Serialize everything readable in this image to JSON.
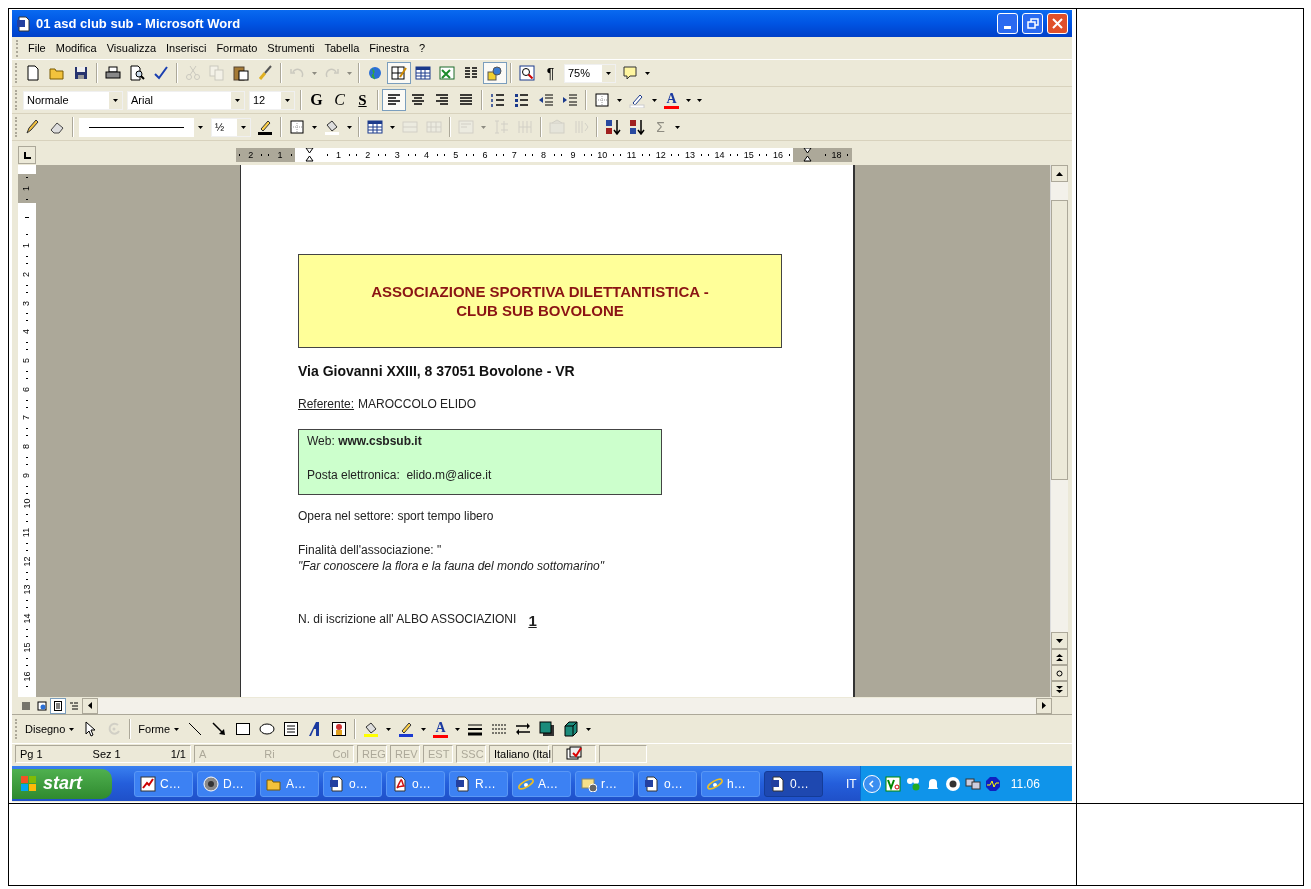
{
  "window": {
    "title": "01 asd club sub - Microsoft Word"
  },
  "menu": [
    {
      "label": "File"
    },
    {
      "label": "Modifica"
    },
    {
      "label": "Visualizza"
    },
    {
      "label": "Inserisci"
    },
    {
      "label": "Formato"
    },
    {
      "label": "Strumenti"
    },
    {
      "label": "Tabella"
    },
    {
      "label": "Finestra"
    },
    {
      "label": "?"
    }
  ],
  "toolbars": [
    {
      "items": [
        {
          "kind": "icon",
          "disabled": false,
          "pressed": false
        },
        {
          "kind": "icon",
          "disabled": false,
          "pressed": false
        },
        {
          "kind": "icon",
          "disabled": false,
          "pressed": false
        },
        {
          "kind": "sep"
        },
        {
          "kind": "icon",
          "disabled": false,
          "pressed": false
        },
        {
          "kind": "icon",
          "disabled": false,
          "pressed": false
        },
        {
          "kind": "icon",
          "disabled": false,
          "pressed": false
        },
        {
          "kind": "sep"
        },
        {
          "kind": "icon",
          "disabled": true,
          "pressed": false
        },
        {
          "kind": "icon",
          "disabled": true,
          "pressed": false
        },
        {
          "kind": "icon",
          "disabled": false,
          "pressed": false
        },
        {
          "kind": "icon",
          "disabled": false,
          "pressed": false
        },
        {
          "kind": "sep"
        },
        {
          "kind": "icon",
          "disabled": true,
          "pressed": false
        },
        {
          "kind": "caret",
          "disabled": true
        },
        {
          "kind": "icon",
          "disabled": true,
          "pressed": false
        },
        {
          "kind": "caret",
          "disabled": true
        },
        {
          "kind": "sep"
        },
        {
          "kind": "icon",
          "disabled": false,
          "pressed": false
        },
        {
          "kind": "icon",
          "disabled": false,
          "pressed": true
        },
        {
          "kind": "icon",
          "disabled": false,
          "pressed": false
        },
        {
          "kind": "icon",
          "disabled": false,
          "pressed": false
        },
        {
          "kind": "icon",
          "disabled": false,
          "pressed": false
        },
        {
          "kind": "icon",
          "disabled": false,
          "pressed": true
        },
        {
          "kind": "sep"
        },
        {
          "kind": "icon",
          "disabled": false,
          "pressed": false
        },
        {
          "kind": "text",
          "label": "¶",
          "disabled": false,
          "pressed": false
        },
        {
          "kind": "combo",
          "value": "75%"
        },
        {
          "kind": "icon",
          "disabled": false,
          "pressed": false
        },
        {
          "kind": "caret",
          "disabled": false
        }
      ]
    },
    {
      "items": [
        {
          "kind": "combo",
          "value": "Normale"
        },
        {
          "kind": "combo",
          "value": "Arial"
        },
        {
          "kind": "combo",
          "value": "12"
        },
        {
          "kind": "sep"
        },
        {
          "kind": "bold",
          "label": "G",
          "disabled": false,
          "pressed": false
        },
        {
          "kind": "italic",
          "label": "C",
          "disabled": false,
          "pressed": false
        },
        {
          "kind": "underline",
          "label": "S",
          "disabled": false,
          "pressed": false
        },
        {
          "kind": "sep"
        },
        {
          "kind": "icon",
          "disabled": false,
          "pressed": true
        },
        {
          "kind": "icon",
          "disabled": false,
          "pressed": false
        },
        {
          "kind": "icon",
          "disabled": false,
          "pressed": false
        },
        {
          "kind": "icon",
          "disabled": false,
          "pressed": false
        },
        {
          "kind": "sep"
        },
        {
          "kind": "icon",
          "disabled": false,
          "pressed": false
        },
        {
          "kind": "icon",
          "disabled": false,
          "pressed": false
        },
        {
          "kind": "icon",
          "disabled": false,
          "pressed": false
        },
        {
          "kind": "icon",
          "disabled": false,
          "pressed": false
        },
        {
          "kind": "sep"
        },
        {
          "kind": "icon",
          "disabled": false,
          "pressed": false
        },
        {
          "kind": "caret",
          "disabled": false
        },
        {
          "kind": "icon",
          "disabled": false,
          "pressed": false
        },
        {
          "kind": "caret",
          "disabled": false
        },
        {
          "kind": "color_text",
          "label": "A",
          "color": "#ff0000",
          "disabled": false,
          "pressed": false
        },
        {
          "kind": "caret",
          "disabled": false
        },
        {
          "kind": "caret",
          "disabled": false
        }
      ]
    },
    {
      "items": [
        {
          "kind": "icon",
          "disabled": false,
          "pressed": false
        },
        {
          "kind": "icon",
          "disabled": false,
          "pressed": false
        },
        {
          "kind": "sep"
        },
        {
          "kind": "line_combo"
        },
        {
          "kind": "combo",
          "value": "½"
        },
        {
          "kind": "icon",
          "disabled": false,
          "pressed": false
        },
        {
          "kind": "sep"
        },
        {
          "kind": "icon",
          "disabled": false,
          "pressed": false
        },
        {
          "kind": "caret",
          "disabled": false
        },
        {
          "kind": "icon",
          "disabled": false,
          "pressed": false
        },
        {
          "kind": "caret",
          "disabled": false
        },
        {
          "kind": "sep"
        },
        {
          "kind": "icon",
          "disabled": false,
          "pressed": false
        },
        {
          "kind": "caret",
          "disabled": false
        },
        {
          "kind": "icon",
          "disabled": true,
          "pressed": false
        },
        {
          "kind": "icon",
          "disabled": true,
          "pressed": false
        },
        {
          "kind": "sep"
        },
        {
          "kind": "icon",
          "disabled": true,
          "pressed": false
        },
        {
          "kind": "caret",
          "disabled": true
        },
        {
          "kind": "icon",
          "disabled": true,
          "pressed": false
        },
        {
          "kind": "icon",
          "disabled": true,
          "pressed": false
        },
        {
          "kind": "sep"
        },
        {
          "kind": "icon",
          "disabled": true,
          "pressed": false
        },
        {
          "kind": "icon",
          "disabled": true,
          "pressed": false
        },
        {
          "kind": "sep"
        },
        {
          "kind": "icon",
          "disabled": false,
          "pressed": false
        },
        {
          "kind": "icon",
          "disabled": false,
          "pressed": false
        },
        {
          "kind": "text",
          "label": "Σ",
          "disabled": true,
          "pressed": false
        },
        {
          "kind": "caret",
          "disabled": false
        }
      ]
    }
  ],
  "ruler": {
    "horizontal": [
      {
        "kind": "label",
        "label": "2",
        "margin": true
      },
      {
        "kind": "label",
        "label": "1",
        "margin": true
      },
      {
        "kind": "marker",
        "margin": false
      },
      {
        "kind": "label",
        "label": "1",
        "margin": false
      },
      {
        "kind": "label",
        "label": "2",
        "margin": false
      },
      {
        "kind": "label",
        "label": "3",
        "margin": false
      },
      {
        "kind": "label",
        "label": "4",
        "margin": false
      },
      {
        "kind": "label",
        "label": "5",
        "margin": false
      },
      {
        "kind": "label",
        "label": "6",
        "margin": false
      },
      {
        "kind": "label",
        "label": "7",
        "margin": false
      },
      {
        "kind": "label",
        "label": "8",
        "margin": false
      },
      {
        "kind": "label",
        "label": "9",
        "margin": false
      },
      {
        "kind": "label",
        "label": "10",
        "margin": false
      },
      {
        "kind": "label",
        "label": "11",
        "margin": false
      },
      {
        "kind": "label",
        "label": "12",
        "margin": false
      },
      {
        "kind": "label",
        "label": "13",
        "margin": false
      },
      {
        "kind": "label",
        "label": "14",
        "margin": false
      },
      {
        "kind": "label",
        "label": "15",
        "margin": false
      },
      {
        "kind": "label",
        "label": "16",
        "margin": false
      },
      {
        "kind": "marker",
        "margin": true
      },
      {
        "kind": "label",
        "label": "18",
        "margin": true
      }
    ],
    "vertical": [
      {
        "kind": "label",
        "label": "1",
        "margin": true
      },
      {
        "kind": "tick",
        "margin": false
      },
      {
        "kind": "label",
        "label": "1",
        "margin": false
      },
      {
        "kind": "label",
        "label": "2",
        "margin": false
      },
      {
        "kind": "label",
        "label": "3",
        "margin": false
      },
      {
        "kind": "label",
        "label": "4",
        "margin": false
      },
      {
        "kind": "label",
        "label": "5",
        "margin": false
      },
      {
        "kind": "label",
        "label": "6",
        "margin": false
      },
      {
        "kind": "label",
        "label": "7",
        "margin": false
      },
      {
        "kind": "label",
        "label": "8",
        "margin": false
      },
      {
        "kind": "label",
        "label": "9",
        "margin": false
      },
      {
        "kind": "label",
        "label": "10",
        "margin": false
      },
      {
        "kind": "label",
        "label": "11",
        "margin": false
      },
      {
        "kind": "label",
        "label": "12",
        "margin": false
      },
      {
        "kind": "label",
        "label": "13",
        "margin": false
      },
      {
        "kind": "label",
        "label": "14",
        "margin": false
      },
      {
        "kind": "label",
        "label": "15",
        "margin": false
      },
      {
        "kind": "label",
        "label": "16",
        "margin": false
      }
    ]
  },
  "document": {
    "title_box": {
      "lines": [
        "ASSOCIAZIONE SPORTIVA DILETTANTISTICA -",
        "CLUB SUB BOVOLONE"
      ]
    },
    "address": "Via Giovanni XXIII, 8  37051 Bovolone - VR",
    "referente": {
      "label": "Referente:",
      "value": "MAROCCOLO ELIDO"
    },
    "contact_box": {
      "web": "Web: **www.csbsub.it**",
      "email": "Posta elettronica:  elido.m@alice.it"
    },
    "sector": "Opera nel settore: sport tempo libero",
    "purpose": {
      "label": "Finalità dell'associazione: \"",
      "quote": "\"Far conoscere la flora e la fauna del mondo sottomarino\""
    },
    "registration": {
      "label": "N. di iscrizione all' ALBO ASSOCIAZIONI",
      "number": "1"
    }
  },
  "view_buttons": [
    {
      "selected": false
    },
    {
      "selected": false
    },
    {
      "selected": true
    },
    {
      "selected": false
    }
  ],
  "drawing_toolbar": {
    "items": [
      {
        "kind": "menu",
        "label": "Disegno"
      },
      {
        "kind": "icon",
        "disabled": false
      },
      {
        "kind": "icon",
        "disabled": true
      },
      {
        "kind": "sep"
      },
      {
        "kind": "menu",
        "label": "Forme"
      },
      {
        "kind": "icon",
        "disabled": false
      },
      {
        "kind": "icon",
        "disabled": false
      },
      {
        "kind": "icon",
        "disabled": false
      },
      {
        "kind": "icon",
        "disabled": false
      },
      {
        "kind": "icon",
        "disabled": false
      },
      {
        "kind": "icon",
        "disabled": false
      },
      {
        "kind": "icon",
        "disabled": false
      },
      {
        "kind": "sep"
      },
      {
        "kind": "icon",
        "disabled": false
      },
      {
        "kind": "caret"
      },
      {
        "kind": "icon",
        "disabled": false
      },
      {
        "kind": "caret"
      },
      {
        "kind": "color_text",
        "label": "A",
        "color": "#ff0000"
      },
      {
        "kind": "caret"
      },
      {
        "kind": "icon",
        "disabled": false
      },
      {
        "kind": "icon",
        "disabled": false
      },
      {
        "kind": "icon",
        "disabled": false
      },
      {
        "kind": "icon",
        "disabled": false
      },
      {
        "kind": "icon",
        "disabled": false
      },
      {
        "kind": "caret"
      }
    ]
  },
  "status_bar": [
    {
      "texts": [
        "Pg 1",
        "Sez 1",
        "1/1"
      ],
      "disabled": false
    },
    {
      "texts": [
        "A",
        "Ri",
        "Col"
      ],
      "disabled": true
    },
    {
      "texts": [
        "REG"
      ],
      "disabled": true
    },
    {
      "texts": [
        "REV"
      ],
      "disabled": true
    },
    {
      "texts": [
        "EST"
      ],
      "disabled": true
    },
    {
      "texts": [
        "SSC"
      ],
      "disabled": true
    },
    {
      "texts": [
        "Italiano (Ital"
      ],
      "disabled": false
    }
  ],
  "taskbar": {
    "start": "start",
    "items": [
      {
        "label": "C…",
        "selected": false
      },
      {
        "label": "D…",
        "selected": false
      },
      {
        "label": "A…",
        "selected": false
      },
      {
        "label": "o…",
        "selected": false
      },
      {
        "label": "o…",
        "selected": false
      },
      {
        "label": "R…",
        "selected": false
      },
      {
        "label": "A…",
        "selected": false
      },
      {
        "label": "r…",
        "selected": false
      },
      {
        "label": "o…",
        "selected": false
      },
      {
        "label": "h…",
        "selected": false
      },
      {
        "label": "0…",
        "selected": true
      }
    ],
    "tray": {
      "language": "IT",
      "clock": "11.06"
    }
  }
}
